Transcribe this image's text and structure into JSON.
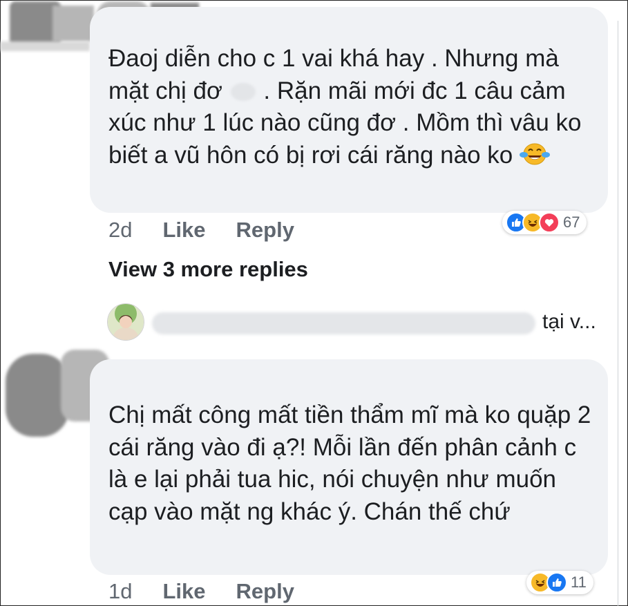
{
  "comments": [
    {
      "text_before_mask": "Đaoj diễn cho c 1 vai khá hay . Nhưng mà mặt chị đơ",
      "text_after_mask": ". Rặn mãi mới đc 1 câu cảm xúc như 1 lúc nào cũng đơ . Mồm thì vâu ko biết a vũ hôn có bị rơi cái răng nào ko",
      "time": "2d",
      "like_label": "Like",
      "reply_label": "Reply",
      "reaction_count": "67",
      "reaction_icons": [
        "like-icon",
        "haha-icon",
        "love-icon"
      ]
    },
    {
      "text": "Chị mất công mất tiền thẩm mĩ mà ko quặp 2 cái răng vào đi ạ?! Mỗi lần đến phân cảnh c là e lại phải tua hic, nói chuyện như muốn cạp vào mặt ng khác ý. Chán thế chứ",
      "time": "1d",
      "like_label": "Like",
      "reply_label": "Reply",
      "reaction_count": "11",
      "reaction_icons": [
        "haha-icon",
        "like-icon"
      ]
    }
  ],
  "view_more_label": "View 3 more replies",
  "reply_preview_text": "tại v...",
  "colors": {
    "bubble": "#f0f2f5",
    "meta_text": "#606770",
    "like_blue": "#1877f2",
    "love_red": "#f33e58",
    "haha_yellow": "#f7b928"
  }
}
